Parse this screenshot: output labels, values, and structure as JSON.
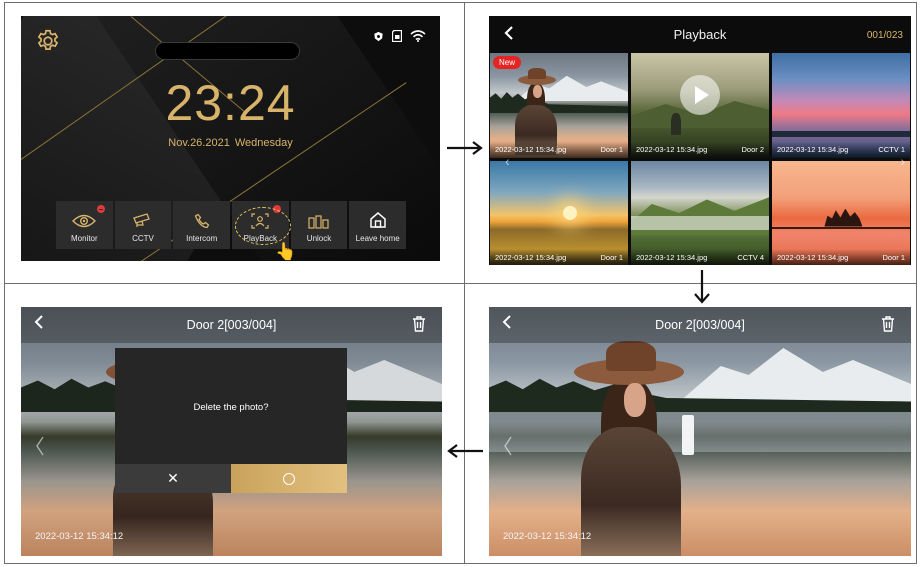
{
  "home": {
    "time": "23:24",
    "date": "Nov.26.2021",
    "weekday": "Wednesday",
    "dock": [
      {
        "label": "Monitor",
        "icon": "eye-icon",
        "badge": "minus"
      },
      {
        "label": "CCTV",
        "icon": "cctv-camera-icon"
      },
      {
        "label": "Intercom",
        "icon": "phone-icon"
      },
      {
        "label": "PlayBack",
        "icon": "playback-icon",
        "badge": "dot"
      },
      {
        "label": "Unlock",
        "icon": "unlock-icon"
      },
      {
        "label": "Leave home",
        "icon": "leave-home-icon"
      }
    ],
    "status_icons": [
      "shield-icon",
      "sd-card-icon",
      "wifi-icon"
    ],
    "colors": {
      "accent": "#d8b46b",
      "badge": "#e03a3a"
    }
  },
  "playback": {
    "title": "Playback",
    "counter": "001/023",
    "new_label": "New",
    "thumbnails": [
      {
        "file": "2022-03-12 15:34.jpg",
        "source": "Door 1"
      },
      {
        "file": "2022-03-12 15:34.jpg",
        "source": "Door 2"
      },
      {
        "file": "2022-03-12 15:34.jpg",
        "source": "CCTV 1"
      },
      {
        "file": "2022-03-12 15:34.jpg",
        "source": "Door 1"
      },
      {
        "file": "2022-03-12 15:34.jpg",
        "source": "CCTV 4"
      },
      {
        "file": "2022-03-12 15:34.jpg",
        "source": "Door 1"
      }
    ]
  },
  "viewer": {
    "title": "Door 2[003/004]",
    "timestamp": "2022-03-12 15:34:12"
  },
  "delete_dialog": {
    "title": "Door 2[003/004]",
    "message": "Delete the photo?",
    "cancel_glyph": "✕",
    "timestamp": "2022-03-12 15:34:12"
  }
}
